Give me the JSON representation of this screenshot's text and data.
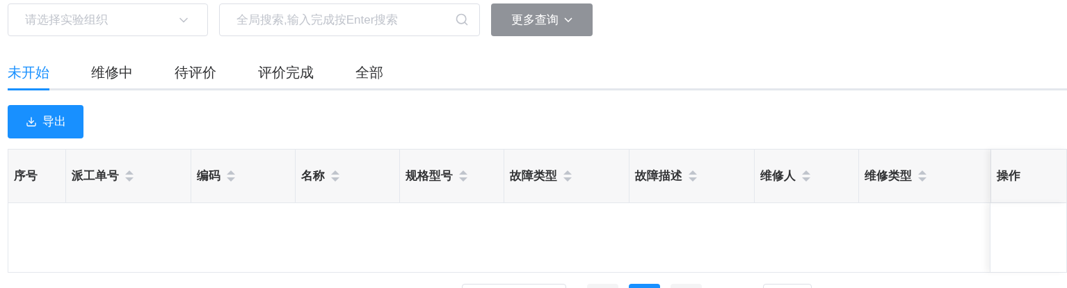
{
  "filters": {
    "org_select": {
      "placeholder": "请选择实验组织"
    },
    "search": {
      "placeholder": "全局搜索,输入完成按Enter搜索"
    },
    "more_button": "更多查询"
  },
  "tabs": [
    {
      "label": "未开始",
      "selected": true
    },
    {
      "label": "维修中",
      "selected": false
    },
    {
      "label": "待评价",
      "selected": false
    },
    {
      "label": "评价完成",
      "selected": false
    },
    {
      "label": "全部",
      "selected": false
    }
  ],
  "export_button": "导出",
  "table": {
    "columns": [
      {
        "label": "序号",
        "sortable": false
      },
      {
        "label": "派工单号",
        "sortable": true
      },
      {
        "label": "编码",
        "sortable": true
      },
      {
        "label": "名称",
        "sortable": true
      },
      {
        "label": "规格型号",
        "sortable": true
      },
      {
        "label": "故障类型",
        "sortable": true
      },
      {
        "label": "故障描述",
        "sortable": true
      },
      {
        "label": "维修人",
        "sortable": true
      },
      {
        "label": "维修类型",
        "sortable": true
      },
      {
        "label": "操作",
        "sortable": false
      }
    ]
  },
  "pagination": {
    "pages": [
      {
        "selected": false
      },
      {
        "selected": true
      },
      {
        "selected": false
      }
    ]
  }
}
